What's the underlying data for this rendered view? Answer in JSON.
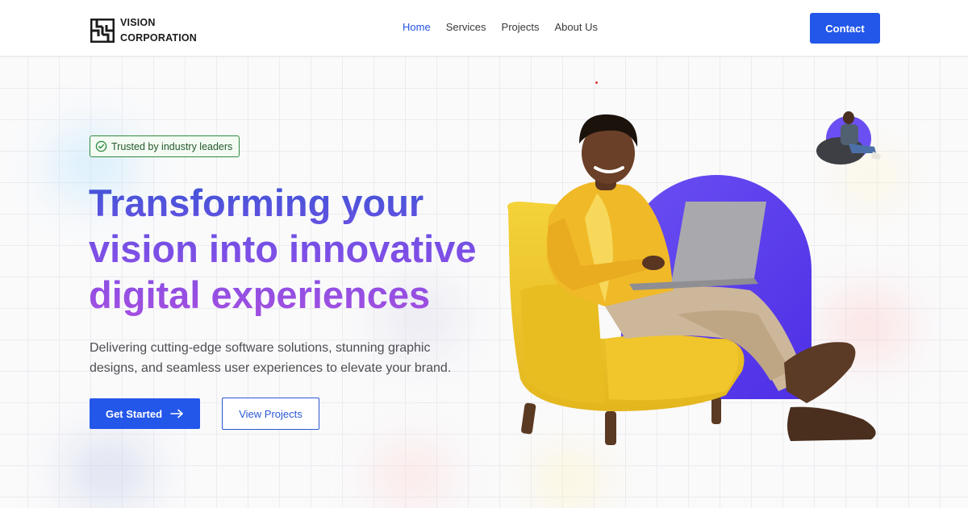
{
  "header": {
    "logo_line1": "VISION",
    "logo_line2": "CORPORATION",
    "nav": [
      {
        "label": "Home",
        "active": true
      },
      {
        "label": "Services",
        "active": false
      },
      {
        "label": "Projects",
        "active": false
      },
      {
        "label": "About Us",
        "active": false
      }
    ],
    "contact_label": "Contact"
  },
  "hero": {
    "badge_label": "Trusted by industry leaders",
    "badge_icon": "check-circle-icon",
    "headline_lines": [
      "Transforming your",
      "vision into innovative",
      "digital experiences"
    ],
    "subtext": "Delivering cutting-edge software solutions, stunning graphic designs, and seamless user experiences to elevate your brand.",
    "primary_cta": "Get Started",
    "primary_cta_icon": "arrow-right-icon",
    "secondary_cta": "View Projects"
  },
  "colors": {
    "accent": "#2357ea",
    "headline_gradient": [
      "#3c55d6",
      "#a44fe0"
    ],
    "badge_green": "#2e8b3f",
    "arch_purple": "#5a3ff0",
    "chair_yellow": "#f2c92e"
  }
}
